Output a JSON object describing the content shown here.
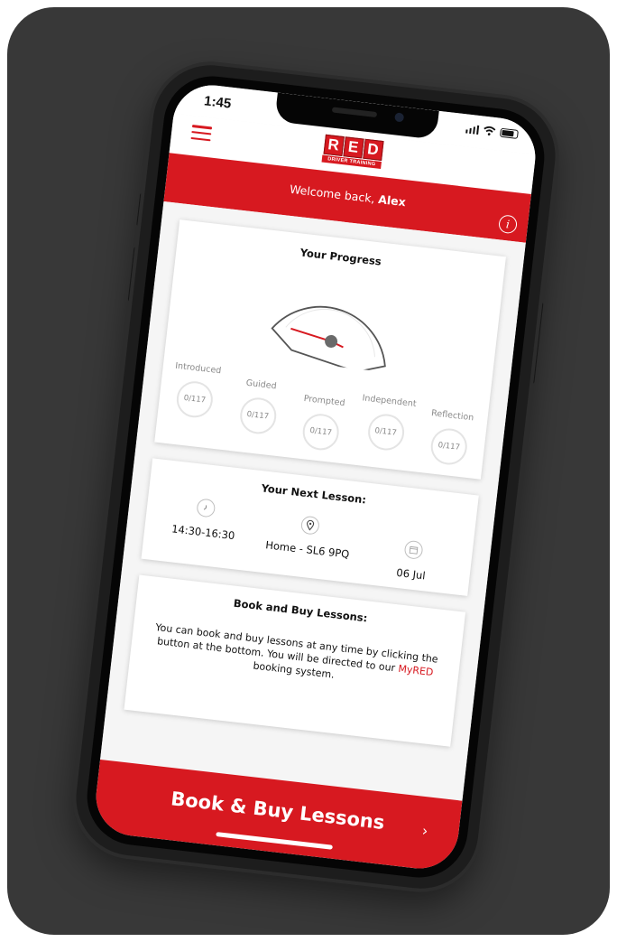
{
  "status_bar": {
    "time": "1:45"
  },
  "header": {
    "logo_text": [
      "R",
      "E",
      "D"
    ],
    "logo_subtext": "DRIVER TRAINING"
  },
  "welcome": {
    "prefix": "Welcome back, ",
    "name": "Alex",
    "info_icon": "i"
  },
  "progress": {
    "title": "Your Progress",
    "stages": [
      {
        "label": "Introduced",
        "value": "0/117"
      },
      {
        "label": "Guided",
        "value": "0/117"
      },
      {
        "label": "Prompted",
        "value": "0/117"
      },
      {
        "label": "Independent",
        "value": "0/117"
      },
      {
        "label": "Reflection",
        "value": "0/117"
      }
    ]
  },
  "next_lesson": {
    "title": "Your Next Lesson:",
    "time": "14:30-16:30",
    "location": "Home - SL6 9PQ",
    "date": "06 Jul",
    "icons": [
      "clock-icon",
      "map-pin-icon",
      "calendar-icon"
    ]
  },
  "booking": {
    "title": "Book and Buy Lessons:",
    "text": "You can book and buy lessons at any time by clicking the button at the bottom. You will be directed to our ",
    "link_text": "MyRED",
    "text_end": " booking system."
  },
  "bottom_button": {
    "label": "Book & Buy Lessons",
    "chevron": "›"
  },
  "colors": {
    "brand_red": "#d71920",
    "background": "#383838"
  }
}
